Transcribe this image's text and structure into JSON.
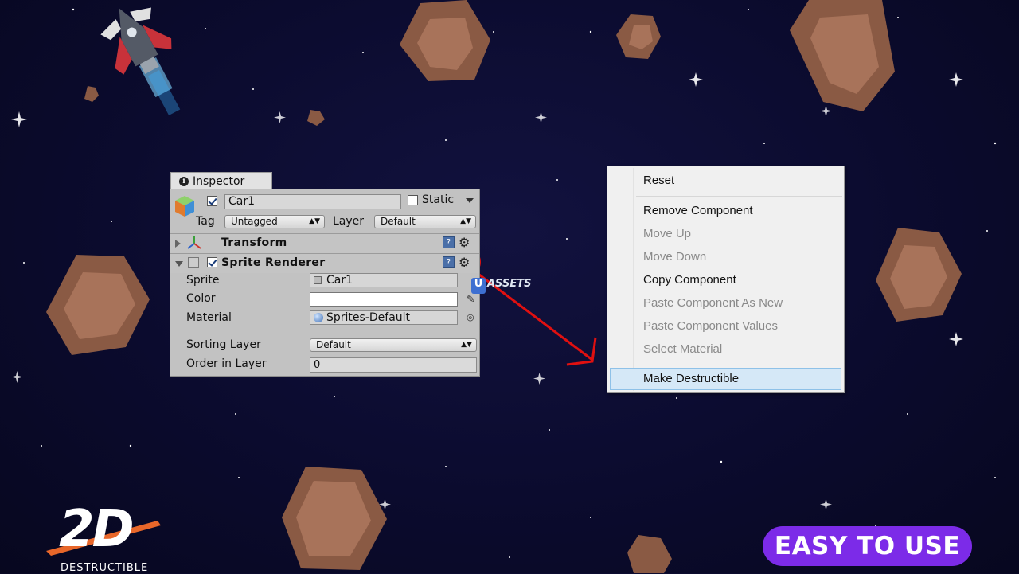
{
  "inspector": {
    "tab_label": "Inspector",
    "object_name": "Car1",
    "object_enabled": true,
    "static_label": "Static",
    "tag_label": "Tag",
    "tag_value": "Untagged",
    "layer_label": "Layer",
    "layer_value": "Default",
    "components": [
      {
        "title": "Transform",
        "expanded": false
      },
      {
        "title": "Sprite Renderer",
        "expanded": true,
        "enabled": true
      }
    ],
    "sprite_renderer": {
      "sprite_label": "Sprite",
      "sprite_value": "Car1",
      "color_label": "Color",
      "color_value": "#ffffff",
      "material_label": "Material",
      "material_value": "Sprites-Default",
      "sorting_layer_label": "Sorting Layer",
      "sorting_layer_value": "Default",
      "order_label": "Order in Layer",
      "order_value": "0"
    }
  },
  "context_menu": {
    "items": [
      {
        "label": "Reset",
        "enabled": true
      },
      {
        "label": "Remove Component",
        "enabled": true
      },
      {
        "label": "Move Up",
        "enabled": false
      },
      {
        "label": "Move Down",
        "enabled": false
      },
      {
        "label": "Copy Component",
        "enabled": true
      },
      {
        "label": "Paste Component As New",
        "enabled": false
      },
      {
        "label": "Paste Component Values",
        "enabled": false
      },
      {
        "label": "Select Material",
        "enabled": false
      },
      {
        "label": "Make Destructible",
        "enabled": true,
        "highlighted": true
      }
    ]
  },
  "branding": {
    "logo_text": "2D",
    "logo_subtitle": "DESTRUCTIBLE",
    "badge": "EASY TO USE",
    "watermark_letter": "U",
    "watermark": "ASSETS"
  },
  "colors": {
    "background": "#0b0b2e",
    "badge": "#7c2be8",
    "highlight_circle": "#e01010",
    "arrow": "#e01010",
    "asteroid": "#8a5a44",
    "asteroid_inner": "#a8735a"
  }
}
